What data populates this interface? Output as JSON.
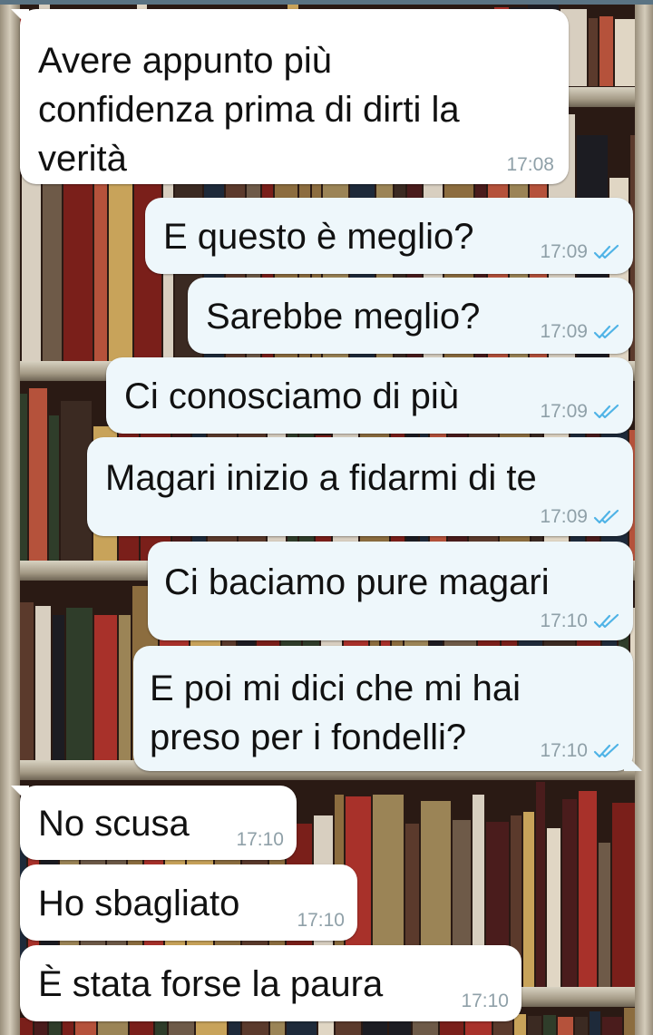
{
  "messages": [
    {
      "id": "m1",
      "direction": "incoming",
      "text": "Avere appunto più\nconfidenza prima di dirti la\nverità",
      "time": "17:08",
      "read": false
    },
    {
      "id": "m2",
      "direction": "outgoing",
      "text": "E questo è meglio?",
      "time": "17:09",
      "read": true
    },
    {
      "id": "m3",
      "direction": "outgoing",
      "text": "Sarebbe meglio?",
      "time": "17:09",
      "read": true
    },
    {
      "id": "m4",
      "direction": "outgoing",
      "text": "Ci conosciamo di più",
      "time": "17:09",
      "read": true
    },
    {
      "id": "m5",
      "direction": "outgoing",
      "text": "Magari inizio a fidarmi di te",
      "time": "17:09",
      "read": true
    },
    {
      "id": "m6",
      "direction": "outgoing",
      "text": "Ci baciamo pure magari",
      "time": "17:10",
      "read": true
    },
    {
      "id": "m7",
      "direction": "outgoing",
      "text": "E poi mi dici che mi hai\npreso per i fondelli?",
      "time": "17:10",
      "read": true
    },
    {
      "id": "m8",
      "direction": "incoming",
      "text": "No scusa",
      "time": "17:10",
      "read": false
    },
    {
      "id": "m9",
      "direction": "incoming",
      "text": "Ho sbagliato",
      "time": "17:10",
      "read": false
    },
    {
      "id": "m10",
      "direction": "incoming",
      "text": "È stata forse la paura",
      "time": "17:10",
      "read": false
    }
  ],
  "icons": {
    "read_receipt": "double-check-icon"
  },
  "colors": {
    "incoming_bubble": "#ffffff",
    "outgoing_bubble": "#eef7fb",
    "read_tick": "#4fb3e6",
    "timestamp": "#8fa0a8"
  }
}
